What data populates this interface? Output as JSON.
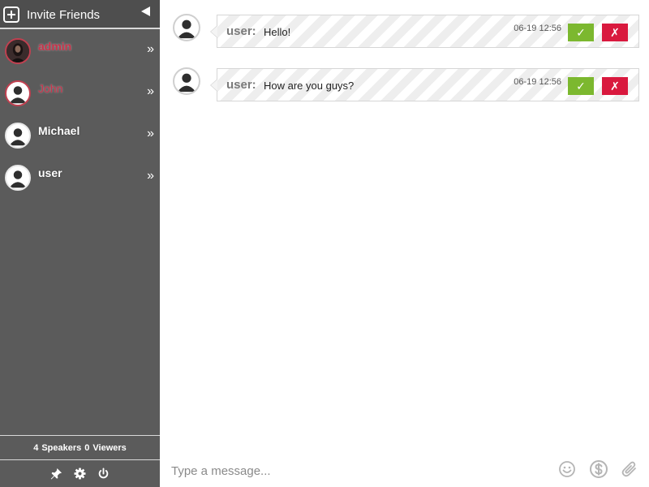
{
  "sidebar": {
    "invite_label": "Invite Friends",
    "users": [
      {
        "name": "admin",
        "style": "highlight",
        "avatar": "photo"
      },
      {
        "name": "John",
        "style": "highlight-normal",
        "avatar": "default"
      },
      {
        "name": "Michael",
        "style": "normal",
        "avatar": "default"
      },
      {
        "name": "user",
        "style": "normal",
        "avatar": "default"
      }
    ],
    "more_icon": "»",
    "stats": {
      "speakers_count": "4",
      "speakers_label": "Speakers",
      "viewers_count": "0",
      "viewers_label": "Viewers"
    },
    "footer_icons": [
      "pin-icon",
      "gear-icon",
      "power-icon"
    ]
  },
  "messages": [
    {
      "sender": "user:",
      "text": "Hello!",
      "time": "06-19 12:56",
      "accept": "✓",
      "reject": "✗"
    },
    {
      "sender": "user:",
      "text": "How are you guys?",
      "time": "06-19 12:56",
      "accept": "✓",
      "reject": "✗"
    }
  ],
  "composer": {
    "placeholder": "Type a message...",
    "icons": [
      "emoji-icon",
      "dollar-icon",
      "attachment-icon"
    ]
  },
  "colors": {
    "sidebar_bg": "#5b5b5b",
    "accept": "#7cb82f",
    "reject": "#d9193e",
    "highlight_name": "#c8324a"
  }
}
